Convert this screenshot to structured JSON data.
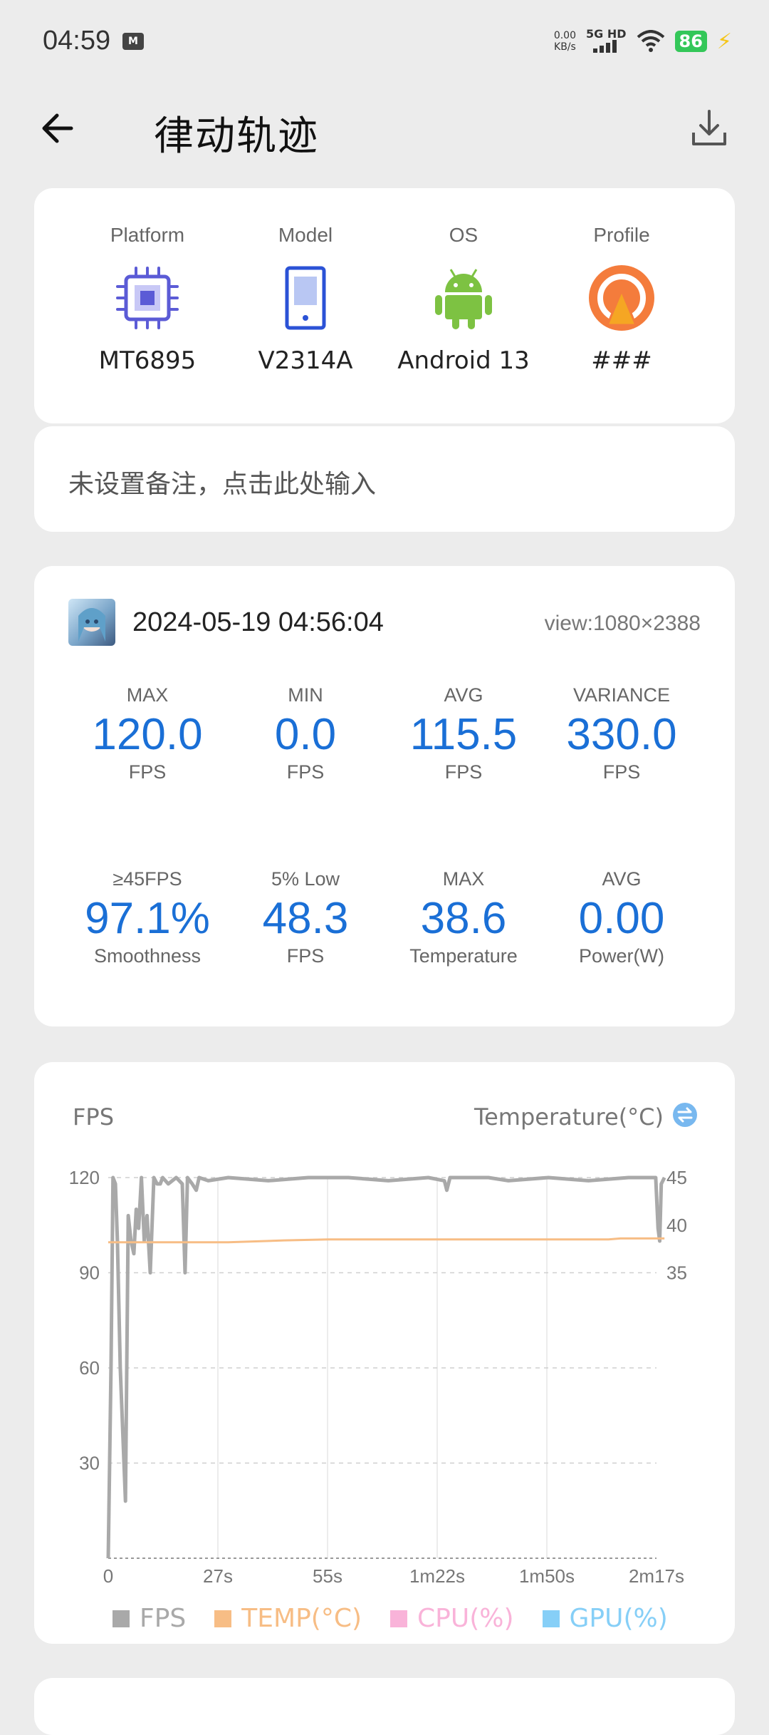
{
  "status": {
    "time": "04:59",
    "net_speed_top": "0.00",
    "net_speed_bottom": "KB/s",
    "network": "5G HD",
    "battery": "86"
  },
  "appbar": {
    "title": "律动轨迹"
  },
  "device": {
    "items": [
      {
        "label": "Platform",
        "value": "MT6895",
        "icon": "cpu-icon"
      },
      {
        "label": "Model",
        "value": "V2314A",
        "icon": "phone-icon"
      },
      {
        "label": "OS",
        "value": "Android 13",
        "icon": "android-icon"
      },
      {
        "label": "Profile",
        "value": "###",
        "icon": "profile-icon"
      }
    ]
  },
  "note": {
    "placeholder": "未设置备注，点击此处输入"
  },
  "session": {
    "datetime": "2024-05-19 04:56:04",
    "view": "view:1080×2388",
    "stats_row1": [
      {
        "label": "MAX",
        "value": "120.0",
        "unit": "FPS"
      },
      {
        "label": "MIN",
        "value": "0.0",
        "unit": "FPS"
      },
      {
        "label": "AVG",
        "value": "115.5",
        "unit": "FPS"
      },
      {
        "label": "VARIANCE",
        "value": "330.0",
        "unit": "FPS"
      }
    ],
    "stats_row2": [
      {
        "label": "≥45FPS",
        "value": "97.1%",
        "unit": "Smoothness"
      },
      {
        "label": "5% Low",
        "value": "48.3",
        "unit": "FPS"
      },
      {
        "label": "MAX",
        "value": "38.6",
        "unit": "Temperature"
      },
      {
        "label": "AVG",
        "value": "0.00",
        "unit": "Power(W)"
      }
    ],
    "accent_color": "#1a6fd6"
  },
  "chart": {
    "left_title": "FPS",
    "right_title": "Temperature(°C)",
    "legend": [
      {
        "label": "FPS",
        "color": "#a9a9a9"
      },
      {
        "label": "TEMP(°C)",
        "color": "#f7bd85"
      },
      {
        "label": "CPU(%)",
        "color": "#f9b3d9"
      },
      {
        "label": "GPU(%)",
        "color": "#86cff7"
      }
    ]
  },
  "chart_data": {
    "type": "line",
    "x_ticks": [
      "0",
      "27s",
      "55s",
      "1m22s",
      "1m50s",
      "2m17s"
    ],
    "x_max_seconds": 137,
    "y_left_ticks": [
      "30",
      "60",
      "90",
      "120"
    ],
    "y_left_range": [
      0,
      120
    ],
    "y_right_ticks": [
      "35",
      "40",
      "45"
    ],
    "grid": true,
    "legend_position": "bottom",
    "series": [
      {
        "name": "FPS",
        "axis": "left",
        "color": "#a9a9a9",
        "points": [
          [
            0,
            0
          ],
          [
            0.7,
            60
          ],
          [
            1.2,
            120
          ],
          [
            1.8,
            118
          ],
          [
            2.3,
            100
          ],
          [
            3,
            60
          ],
          [
            4.3,
            18
          ],
          [
            5,
            108
          ],
          [
            5.7,
            100
          ],
          [
            6.4,
            96
          ],
          [
            7,
            110
          ],
          [
            7.6,
            104
          ],
          [
            8.3,
            120
          ],
          [
            9,
            100
          ],
          [
            9.7,
            108
          ],
          [
            10.5,
            90
          ],
          [
            11.4,
            120
          ],
          [
            12.2,
            118
          ],
          [
            13,
            118
          ],
          [
            13.6,
            120
          ],
          [
            15,
            118
          ],
          [
            17,
            120
          ],
          [
            18.5,
            118
          ],
          [
            19.2,
            90
          ],
          [
            19.8,
            120
          ],
          [
            21,
            118
          ],
          [
            22,
            116
          ],
          [
            22.7,
            120
          ],
          [
            25,
            119
          ],
          [
            30,
            120
          ],
          [
            40,
            119
          ],
          [
            50,
            120
          ],
          [
            60,
            120
          ],
          [
            70,
            119
          ],
          [
            80,
            120
          ],
          [
            84,
            119
          ],
          [
            84.6,
            116
          ],
          [
            85.4,
            120
          ],
          [
            95,
            120
          ],
          [
            100,
            119
          ],
          [
            110,
            120
          ],
          [
            120,
            119
          ],
          [
            130,
            120
          ],
          [
            136.8,
            120
          ],
          [
            137.4,
            104
          ],
          [
            137.8,
            100
          ],
          [
            138.2,
            118
          ],
          [
            139,
            120
          ]
        ]
      },
      {
        "name": "TEMP(°C)",
        "axis": "right",
        "color": "#f7bd85",
        "points": [
          [
            0,
            38.2
          ],
          [
            30,
            38.2
          ],
          [
            44,
            38.4
          ],
          [
            55,
            38.5
          ],
          [
            80,
            38.5
          ],
          [
            100,
            38.5
          ],
          [
            125,
            38.5
          ],
          [
            128,
            38.6
          ],
          [
            139,
            38.6
          ]
        ]
      },
      {
        "name": "CPU(%)",
        "axis": "right",
        "color": "#f9b3d9",
        "points": []
      },
      {
        "name": "GPU(%)",
        "axis": "right",
        "color": "#86cff7",
        "points": []
      }
    ]
  }
}
